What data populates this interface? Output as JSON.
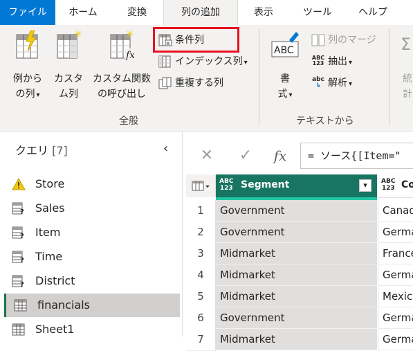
{
  "menu": {
    "tabs": [
      "ファイル",
      "ホーム",
      "変換",
      "列の追加",
      "表示",
      "ツール",
      "ヘルプ"
    ]
  },
  "ribbon": {
    "general": {
      "example_col": [
        "例から",
        "の列"
      ],
      "custom_col": [
        "カスタ",
        "ム列"
      ],
      "custom_func": [
        "カスタム関数",
        "の呼び出し"
      ],
      "conditional": "条件列",
      "index": "インデックス列",
      "duplicate": "重複する列",
      "group_label": "全般"
    },
    "text": {
      "format": [
        "書",
        "式"
      ],
      "merge": "列のマージ",
      "extract": "抽出",
      "parse": "解析",
      "group_label": "テキストから",
      "abc": "ABC",
      "abc123_top": "ABC",
      "abc123_bottom": "123",
      "abc_small": "abc"
    },
    "partial": [
      "統",
      "計"
    ]
  },
  "queries": {
    "title": "クエリ",
    "count": "[7]",
    "items": [
      {
        "name": "Store",
        "icon": "warning-icon"
      },
      {
        "name": "Sales",
        "icon": "table-query-icon"
      },
      {
        "name": "Item",
        "icon": "table-query-icon"
      },
      {
        "name": "Time",
        "icon": "table-query-icon"
      },
      {
        "name": "District",
        "icon": "table-query-icon"
      },
      {
        "name": "financials",
        "icon": "table-icon",
        "selected": true
      },
      {
        "name": "Sheet1",
        "icon": "table-icon"
      }
    ]
  },
  "formula": {
    "cancel": "✕",
    "confirm": "✓",
    "fx": "fx",
    "text": "= ソース{[Item=\""
  },
  "grid": {
    "col1_type_top": "ABC",
    "col1_type_bottom": "123",
    "col1_name": "Segment",
    "col2_type_top": "ABC",
    "col2_type_bottom": "123",
    "col2_name": "Co",
    "rows": [
      {
        "n": "1",
        "segment": "Government",
        "country": "Canada"
      },
      {
        "n": "2",
        "segment": "Government",
        "country": "Germany"
      },
      {
        "n": "3",
        "segment": "Midmarket",
        "country": "France"
      },
      {
        "n": "4",
        "segment": "Midmarket",
        "country": "Germany"
      },
      {
        "n": "5",
        "segment": "Midmarket",
        "country": "Mexico"
      },
      {
        "n": "6",
        "segment": "Government",
        "country": "Germany"
      },
      {
        "n": "7",
        "segment": "Midmarket",
        "country": "Germany"
      }
    ]
  },
  "colors": {
    "accent": "#0078d4",
    "column_header": "#187561",
    "highlight": "#e81123"
  }
}
